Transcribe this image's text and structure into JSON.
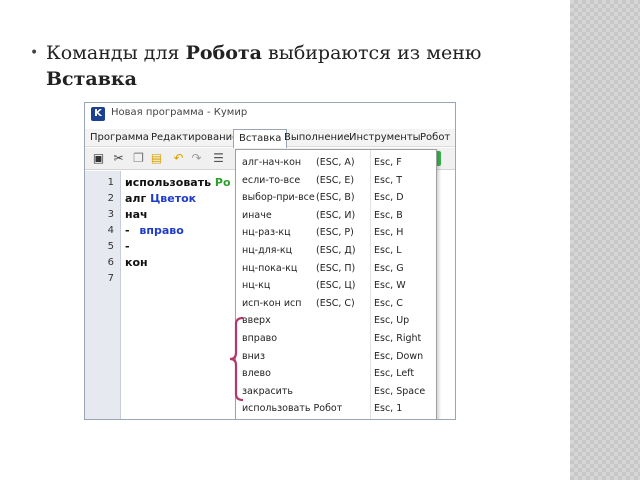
{
  "bullet": {
    "before_robot": "Команды для ",
    "robot": "Робота",
    "middle": " выбираются из меню ",
    "insert": "Вставка"
  },
  "window": {
    "title": "Новая программа - Кумир",
    "icon_letter": "K",
    "menus": [
      "Программа",
      "Редактирование",
      "Вставка",
      "Выполнение",
      "Инструменты",
      "Робот"
    ]
  },
  "editor": {
    "line_numbers": [
      "1",
      "2",
      "3",
      "4",
      "5",
      "6",
      "7"
    ],
    "line1_kw": "использовать",
    "line1_rest": "Ро",
    "line2_kw": "алг",
    "line2_name": "Цветок",
    "line3": "нач",
    "line4_dash": "-",
    "line4_cmd": "вправо",
    "line5": "-",
    "line6": "кон"
  },
  "dropdown": {
    "items": [
      {
        "label": "алг-нач-кон",
        "hotkey": "(ESC, A)",
        "shortcut": "Esc, F"
      },
      {
        "label": "если-то-все",
        "hotkey": "(ESC, E)",
        "shortcut": "Esc, T"
      },
      {
        "label": "выбор-при-все",
        "hotkey": "(ESC, B)",
        "shortcut": "Esc, D"
      },
      {
        "label": "иначе",
        "hotkey": "(ESC, И)",
        "shortcut": "Esc, B"
      },
      {
        "label": "нц-раз-кц",
        "hotkey": "(ESC, P)",
        "shortcut": "Esc, H"
      },
      {
        "label": "нц-для-кц",
        "hotkey": "(ESC, Д)",
        "shortcut": "Esc, L"
      },
      {
        "label": "нц-пока-кц",
        "hotkey": "(ESC, П)",
        "shortcut": "Esc, G"
      },
      {
        "label": "нц-кц",
        "hotkey": "(ESC, Ц)",
        "shortcut": "Esc, W"
      },
      {
        "label": "исп-кон исп",
        "hotkey": "(ESC, C)",
        "shortcut": "Esc, C"
      },
      {
        "label": "вверх",
        "hotkey": "",
        "shortcut": "Esc, Up"
      },
      {
        "label": "вправо",
        "hotkey": "",
        "shortcut": "Esc, Right"
      },
      {
        "label": "вниз",
        "hotkey": "",
        "shortcut": "Esc, Down"
      },
      {
        "label": "влево",
        "hotkey": "",
        "shortcut": "Esc, Left"
      },
      {
        "label": "закрасить",
        "hotkey": "",
        "shortcut": "Esc, Space"
      },
      {
        "label": "использовать Робот",
        "hotkey": "",
        "shortcut": "Esc, 1"
      }
    ]
  },
  "colors": {
    "bracket": "#b03a6b",
    "keyword_blue": "#1f3cc8",
    "robot_green": "#2aa02a"
  }
}
